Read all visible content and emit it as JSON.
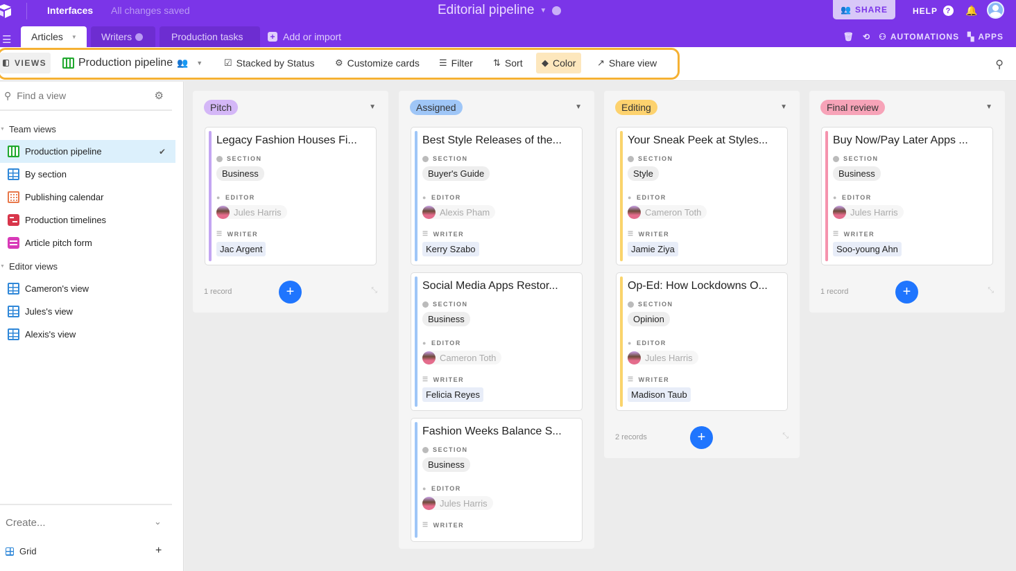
{
  "topbar": {
    "section_label": "Interfaces",
    "save_status": "All changes saved",
    "base_title": "Editorial pipeline",
    "share_label": "SHARE",
    "help_label": "HELP"
  },
  "tabs": [
    {
      "label": "Articles",
      "active": true
    },
    {
      "label": "Writers"
    },
    {
      "label": "Production tasks"
    },
    {
      "label": "Add or import"
    }
  ],
  "right_tools": {
    "automations": "AUTOMATIONS",
    "apps": "APPS"
  },
  "viewbar": {
    "views_label": "VIEWS",
    "current_view": "Production pipeline",
    "stacked": "Stacked by Status",
    "customize": "Customize cards",
    "filter": "Filter",
    "sort": "Sort",
    "color": "Color",
    "share_view": "Share view",
    "highlight_color": "#f5b133"
  },
  "sidebar": {
    "find_placeholder": "Find a view",
    "groups": [
      {
        "label": "Team views",
        "items": [
          {
            "label": "Production pipeline",
            "type": "kanban",
            "selected": true
          },
          {
            "label": "By section",
            "type": "grid"
          },
          {
            "label": "Publishing calendar",
            "type": "calendar"
          },
          {
            "label": "Production timelines",
            "type": "gantt"
          },
          {
            "label": "Article pitch form",
            "type": "form"
          }
        ]
      },
      {
        "label": "Editor views",
        "items": [
          {
            "label": "Cameron's view",
            "type": "grid"
          },
          {
            "label": "Jules's view",
            "type": "grid"
          },
          {
            "label": "Alexis's view",
            "type": "grid"
          }
        ]
      }
    ],
    "create_label": "Create...",
    "create_grid": "Grid"
  },
  "labels": {
    "section": "SECTION",
    "editor": "EDITOR",
    "writer": "WRITER"
  },
  "columns": [
    {
      "status": "Pitch",
      "badge_bg": "#d4b7f7",
      "bar": "#c3a6f2",
      "records": "1 record",
      "cards": [
        {
          "title": "Legacy Fashion Houses Fi...",
          "section": "Business",
          "editor": "Jules Harris",
          "writer": "Jac Argent"
        }
      ]
    },
    {
      "status": "Assigned",
      "badge_bg": "#9fc6f7",
      "bar": "#9fc6f7",
      "records": "",
      "cards": [
        {
          "title": "Best Style Releases of the...",
          "section": "Buyer's Guide",
          "editor": "Alexis Pham",
          "writer": "Kerry Szabo"
        },
        {
          "title": "Social Media Apps Restor...",
          "section": "Business",
          "editor": "Cameron Toth",
          "writer": "Felicia Reyes"
        },
        {
          "title": "Fashion Weeks Balance S...",
          "section": "Business",
          "editor": "Jules Harris",
          "writer": ""
        }
      ]
    },
    {
      "status": "Editing",
      "badge_bg": "#fdd26e",
      "bar": "#fad46c",
      "records": "2 records",
      "cards": [
        {
          "title": "Your Sneak Peek at Styles...",
          "section": "Style",
          "editor": "Cameron Toth",
          "writer": "Jamie Ziya"
        },
        {
          "title": "Op-Ed: How Lockdowns O...",
          "section": "Opinion",
          "editor": "Jules Harris",
          "writer": "Madison Taub"
        }
      ]
    },
    {
      "status": "Final review",
      "badge_bg": "#f7a3b8",
      "bar": "#f593ad",
      "records": "1 record",
      "cards": [
        {
          "title": "Buy Now/Pay Later Apps ...",
          "section": "Business",
          "editor": "Jules Harris",
          "writer": "Soo-young Ahn"
        }
      ]
    }
  ]
}
